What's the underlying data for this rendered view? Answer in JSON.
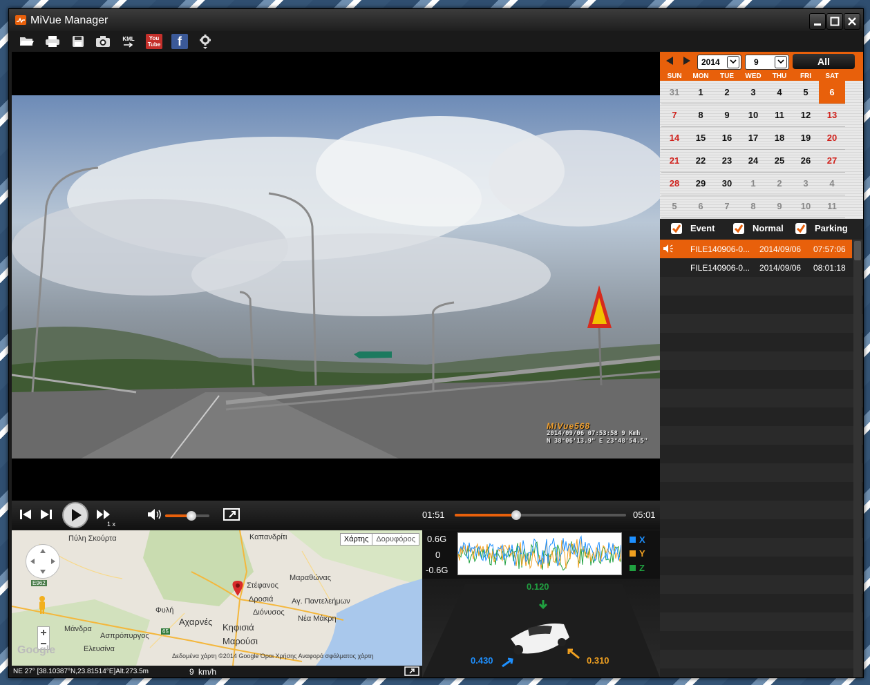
{
  "window": {
    "title": "MiVue Manager"
  },
  "toolbar": {
    "items": [
      "open-folder-icon",
      "print-icon",
      "save-icon",
      "snapshot-icon",
      "kml-export-icon",
      "youtube-icon",
      "facebook-icon",
      "settings-icon"
    ],
    "kml_label": "KML",
    "youtube_label": "You Tube",
    "facebook_label": "f"
  },
  "video": {
    "osd_brand": "MiVue568",
    "osd_line1": "2014/09/06  07:53:58  9 Kmh",
    "osd_line2": "N 38°06'13.9\"  E   23°48'54.5\""
  },
  "controls": {
    "speed": "1 x",
    "current_time": "01:51",
    "total_time": "05:01",
    "progress": 0.36,
    "volume": 0.6
  },
  "map": {
    "toggle": [
      "Χάρτης",
      "Δορυφόρος"
    ],
    "labels": [
      "Πύλη Σκούρτα",
      "Καπανδρίτι",
      "Μαραθώνας",
      "Στέφανος",
      "Δροσιά",
      "Αγ. Παντελεήμων",
      "Διόνυσος",
      "Φυλή",
      "Αχαρνές",
      "Κηφισιά",
      "Νέα Μάκρη",
      "Μάνδρα",
      "Ασπρόπυργος",
      "Ελευσίνα",
      "Μαρούσι",
      "E962",
      "65"
    ],
    "footer": "Δεδομένα χάρτη ©2014 Google   Όροι Χρήσης   Αναφορά σφάλματος χάρτη",
    "logo": "Google",
    "status": "NE 27° [38.10387°N,23.81514°E]Alt.273.5m",
    "speed_value": "9",
    "speed_unit": "km/h"
  },
  "gsensor": {
    "y_max": "0.6G",
    "y_mid": "0",
    "y_min": "-0.6G",
    "axes": [
      "X",
      "Y",
      "Z"
    ],
    "colors": {
      "x": "#1e90ff",
      "y": "#f0a020",
      "z": "#20a040"
    },
    "z_value": "0.120",
    "x_value": "0.430",
    "y_value": "0.310"
  },
  "calendar": {
    "year": "2014",
    "month": "9",
    "all_label": "All",
    "weekdays": [
      "SUN",
      "MON",
      "TUE",
      "WED",
      "THU",
      "FRI",
      "SAT"
    ],
    "weeks": [
      [
        "31",
        "1",
        "2",
        "3",
        "4",
        "5",
        "6"
      ],
      [
        "7",
        "8",
        "9",
        "10",
        "11",
        "12",
        "13"
      ],
      [
        "14",
        "15",
        "16",
        "17",
        "18",
        "19",
        "20"
      ],
      [
        "21",
        "22",
        "23",
        "24",
        "25",
        "26",
        "27"
      ],
      [
        "28",
        "29",
        "30",
        "1",
        "2",
        "3",
        "4"
      ],
      [
        "5",
        "6",
        "7",
        "8",
        "9",
        "10",
        "11"
      ]
    ],
    "today": "6"
  },
  "filters": [
    {
      "label": "Event",
      "checked": true
    },
    {
      "label": "Normal",
      "checked": true
    },
    {
      "label": "Parking",
      "checked": true
    }
  ],
  "files": [
    {
      "name": "FILE140906-0...",
      "date": "2014/09/06",
      "time": "07:57:06",
      "active": true
    },
    {
      "name": "FILE140906-0...",
      "date": "2014/09/06",
      "time": "08:01:18",
      "active": false
    }
  ],
  "accent": "#e8600b"
}
